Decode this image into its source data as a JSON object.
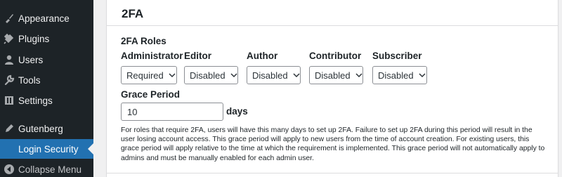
{
  "sidebar": {
    "items": [
      {
        "label": "Appearance",
        "icon": "paintbrush-icon"
      },
      {
        "label": "Plugins",
        "icon": "plug-icon"
      },
      {
        "label": "Users",
        "icon": "user-icon"
      },
      {
        "label": "Tools",
        "icon": "wrench-icon"
      },
      {
        "label": "Settings",
        "icon": "settings-icon"
      },
      {
        "label": "Gutenberg",
        "icon": "pen-icon"
      },
      {
        "label": "Login Security",
        "icon": "",
        "active": true
      }
    ],
    "collapse_label": "Collapse Menu",
    "active_color": "#2271b1",
    "background": "#1d2327"
  },
  "panel": {
    "title": "2FA",
    "roles_heading": "2FA Roles",
    "roles": [
      {
        "name": "Administrator",
        "value": "Required"
      },
      {
        "name": "Editor",
        "value": "Disabled"
      },
      {
        "name": "Author",
        "value": "Disabled"
      },
      {
        "name": "Contributor",
        "value": "Disabled"
      },
      {
        "name": "Subscriber",
        "value": "Disabled"
      }
    ],
    "grace_heading": "Grace Period",
    "grace_value": "10",
    "grace_unit": "days",
    "description": "For roles that require 2FA, users will have this many days to set up 2FA. Failure to set up 2FA during this period will result in the user losing account access. This grace period will apply to new users from the time of account creation. For existing users, this grace period will apply relative to the time at which the requirement is implemented. This grace period will not automatically apply to admins and must be manually enabled for each admin user."
  }
}
